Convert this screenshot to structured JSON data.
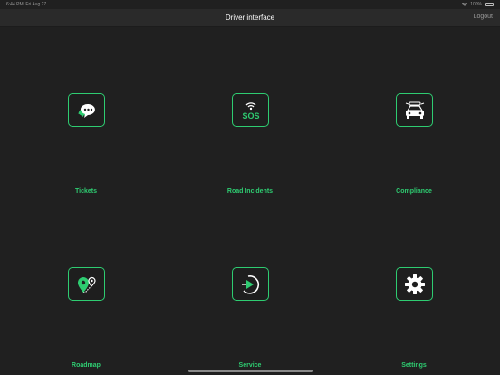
{
  "status_bar": {
    "time": "6:44 PM",
    "date": "Fri Aug 27",
    "battery": "100%",
    "wifi_icon": "wifi-icon",
    "battery_icon": "battery-icon"
  },
  "nav": {
    "title": "Driver interface",
    "logout_label": "Logout"
  },
  "tiles": [
    {
      "label": "Tickets",
      "icon": "chat-bubbles-icon"
    },
    {
      "label": "Road Incidents",
      "icon": "sos-icon"
    },
    {
      "label": "Compliance",
      "icon": "car-icon"
    },
    {
      "label": "Roadmap",
      "icon": "route-pin-icon"
    },
    {
      "label": "Service",
      "icon": "service-icon"
    },
    {
      "label": "Settings",
      "icon": "gear-icon"
    }
  ],
  "colors": {
    "accent": "#2ecc71",
    "background": "#202020",
    "navbar": "#2a2a2a"
  }
}
